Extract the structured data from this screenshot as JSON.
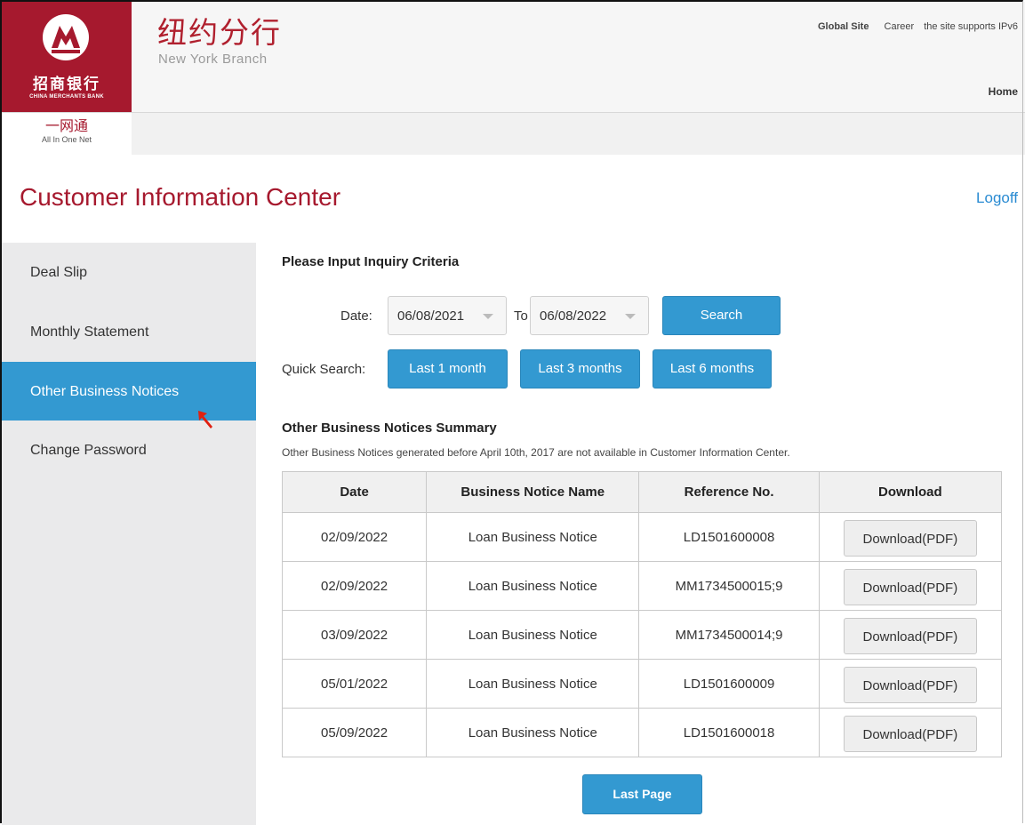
{
  "header": {
    "logo_cn": "招商银行",
    "logo_en": "CHINA MERCHANTS BANK",
    "branch_cn": "纽约分行",
    "branch_en": "New York Branch",
    "links": {
      "global_site": "Global Site",
      "career": "Career",
      "ipv6": "the site supports IPv6"
    },
    "home": "Home",
    "brand_color": "#a6192e"
  },
  "subbar": {
    "product_cn": "一网通",
    "product_en": "All In One Net"
  },
  "page": {
    "title": "Customer Information Center",
    "logoff": "Logoff"
  },
  "sidebar": {
    "items": [
      {
        "label": "Deal Slip"
      },
      {
        "label": "Monthly Statement"
      },
      {
        "label": "Other Business Notices",
        "active": true
      },
      {
        "label": "Change Password"
      }
    ],
    "active_color": "#3399d1"
  },
  "criteria": {
    "heading": "Please Input Inquiry Criteria",
    "date_label": "Date:",
    "from": "06/08/2021",
    "to_label": "To",
    "to": "06/08/2022",
    "search": "Search",
    "quick_label": "Quick Search:",
    "quick": [
      "Last 1 month",
      "Last 3 months",
      "Last 6 months"
    ]
  },
  "summary": {
    "heading": "Other Business Notices Summary",
    "note": "Other Business Notices generated before April 10th, 2017 are not available in Customer Information Center.",
    "columns": [
      "Date",
      "Business Notice Name",
      "Reference No.",
      "Download"
    ],
    "rows": [
      {
        "date": "02/09/2022",
        "name": "Loan Business Notice",
        "ref": "LD1501600008",
        "download": "Download(PDF)"
      },
      {
        "date": "02/09/2022",
        "name": "Loan Business Notice",
        "ref": "MM1734500015;9",
        "download": "Download(PDF)"
      },
      {
        "date": "03/09/2022",
        "name": "Loan Business Notice",
        "ref": "MM1734500014;9",
        "download": "Download(PDF)"
      },
      {
        "date": "05/01/2022",
        "name": "Loan Business Notice",
        "ref": "LD1501600009",
        "download": "Download(PDF)"
      },
      {
        "date": "05/09/2022",
        "name": "Loan Business Notice",
        "ref": "LD1501600018",
        "download": "Download(PDF)"
      }
    ],
    "last_page": "Last Page"
  }
}
